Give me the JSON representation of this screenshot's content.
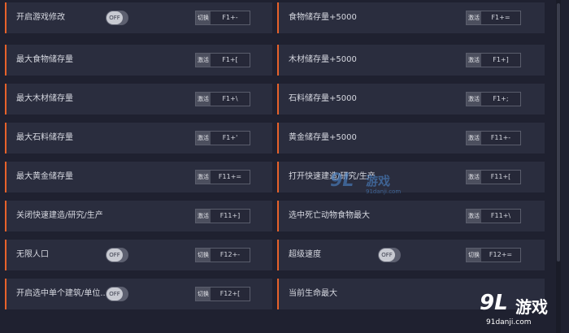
{
  "colors": {
    "accent": "#e8622a",
    "row_bg": "#2a2d3e",
    "page_bg": "#1f2130"
  },
  "left": [
    {
      "label": "开启游戏修改",
      "control": "toggle",
      "toggle_text": "OFF",
      "kind": "切换",
      "key": "F1+-"
    },
    {
      "label": "最大食物储存量",
      "control": "none",
      "kind": "激活",
      "key": "F1+["
    },
    {
      "label": "最大木材储存量",
      "control": "none",
      "kind": "激活",
      "key": "F1+\\"
    },
    {
      "label": "最大石料储存量",
      "control": "none",
      "kind": "激活",
      "key": "F1+'"
    },
    {
      "label": "最大黄金储存量",
      "control": "none",
      "kind": "激活",
      "key": "F11+="
    },
    {
      "label": "关闭快速建造/研究/生产",
      "control": "none",
      "kind": "激活",
      "key": "F11+]"
    },
    {
      "label": "无限人口",
      "control": "toggle",
      "toggle_text": "OFF",
      "kind": "切换",
      "key": "F12+-"
    },
    {
      "label": "开启选中单个建筑/单位...",
      "control": "toggle",
      "toggle_text": "OFF",
      "kind": "切换",
      "key": "F12+["
    }
  ],
  "right": [
    {
      "label": "食物储存量+5000",
      "control": "none",
      "kind": "激活",
      "key": "F1+="
    },
    {
      "label": "木材储存量+5000",
      "control": "none",
      "kind": "激活",
      "key": "F1+]"
    },
    {
      "label": "石料储存量+5000",
      "control": "none",
      "kind": "激活",
      "key": "F1+;"
    },
    {
      "label": "黄金储存量+5000",
      "control": "none",
      "kind": "激活",
      "key": "F11+-"
    },
    {
      "label": "打开快速建造/研究/生产",
      "control": "none",
      "kind": "激活",
      "key": "F11+["
    },
    {
      "label": "选中死亡动物食物最大",
      "control": "none",
      "kind": "激活",
      "key": "F11+\\"
    },
    {
      "label": "超级速度",
      "control": "toggle",
      "toggle_text": "OFF",
      "kind": "切换",
      "key": "F12+="
    },
    {
      "label": "当前生命最大",
      "control": "none",
      "kind": "",
      "key": ""
    }
  ],
  "watermark": {
    "center_logo": "9L",
    "center_text": "游戏",
    "center_sub": "91danji.com",
    "corner_logo": "9L",
    "corner_text": "游戏",
    "corner_sub": "91danji.com"
  }
}
